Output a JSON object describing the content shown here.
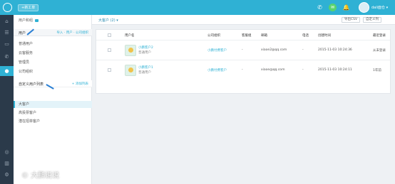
{
  "topbar": {
    "new_button": "+新工单",
    "username": "dali面仓 ▾"
  },
  "rail": {
    "items": [
      "home-icon",
      "list-icon",
      "chat-icon",
      "phone-icon",
      "user-icon",
      "globe-icon",
      "chart-icon",
      "settings-icon"
    ]
  },
  "sidebar": {
    "title": "用户和组",
    "users_header": "用户",
    "users_actions": "导入 · 用户 · 公司组织",
    "user_items": [
      "普通用户",
      "云客服务",
      "管理员",
      "公司组织"
    ],
    "custom_header": "自定义用户列表",
    "custom_action": "+ 添加列表",
    "custom_items": [
      "大客户",
      "高投票客户",
      "潜在招单客户"
    ]
  },
  "main": {
    "title": "大客户 (2) ▾",
    "export_button": "导出CSV",
    "custom_cols_button": "自定义列",
    "columns": [
      "用户名",
      "公司组织",
      "客服组",
      "邮箱",
      "电话",
      "创建时间",
      "最近登录"
    ],
    "rows": [
      {
        "name": "小鹏客户2",
        "role": "普通用户",
        "company": "小鹏付费客户",
        "group": "-",
        "email": "xiaoe2@qq.com",
        "phone": "-",
        "created": "2015-11-03 10:24:36",
        "last_login": "从未登录"
      },
      {
        "name": "小鹏客户1",
        "role": "普通用户",
        "company": "小鹏付费客户",
        "group": "-",
        "email": "xiaoe@qq.com",
        "phone": "-",
        "created": "2015-11-03 10:24:11",
        "last_login": "1年前"
      }
    ]
  },
  "watermark": "© 大鹏说说",
  "colors": {
    "accent": "#2fb1d4",
    "rail": "#2b3a4a"
  }
}
